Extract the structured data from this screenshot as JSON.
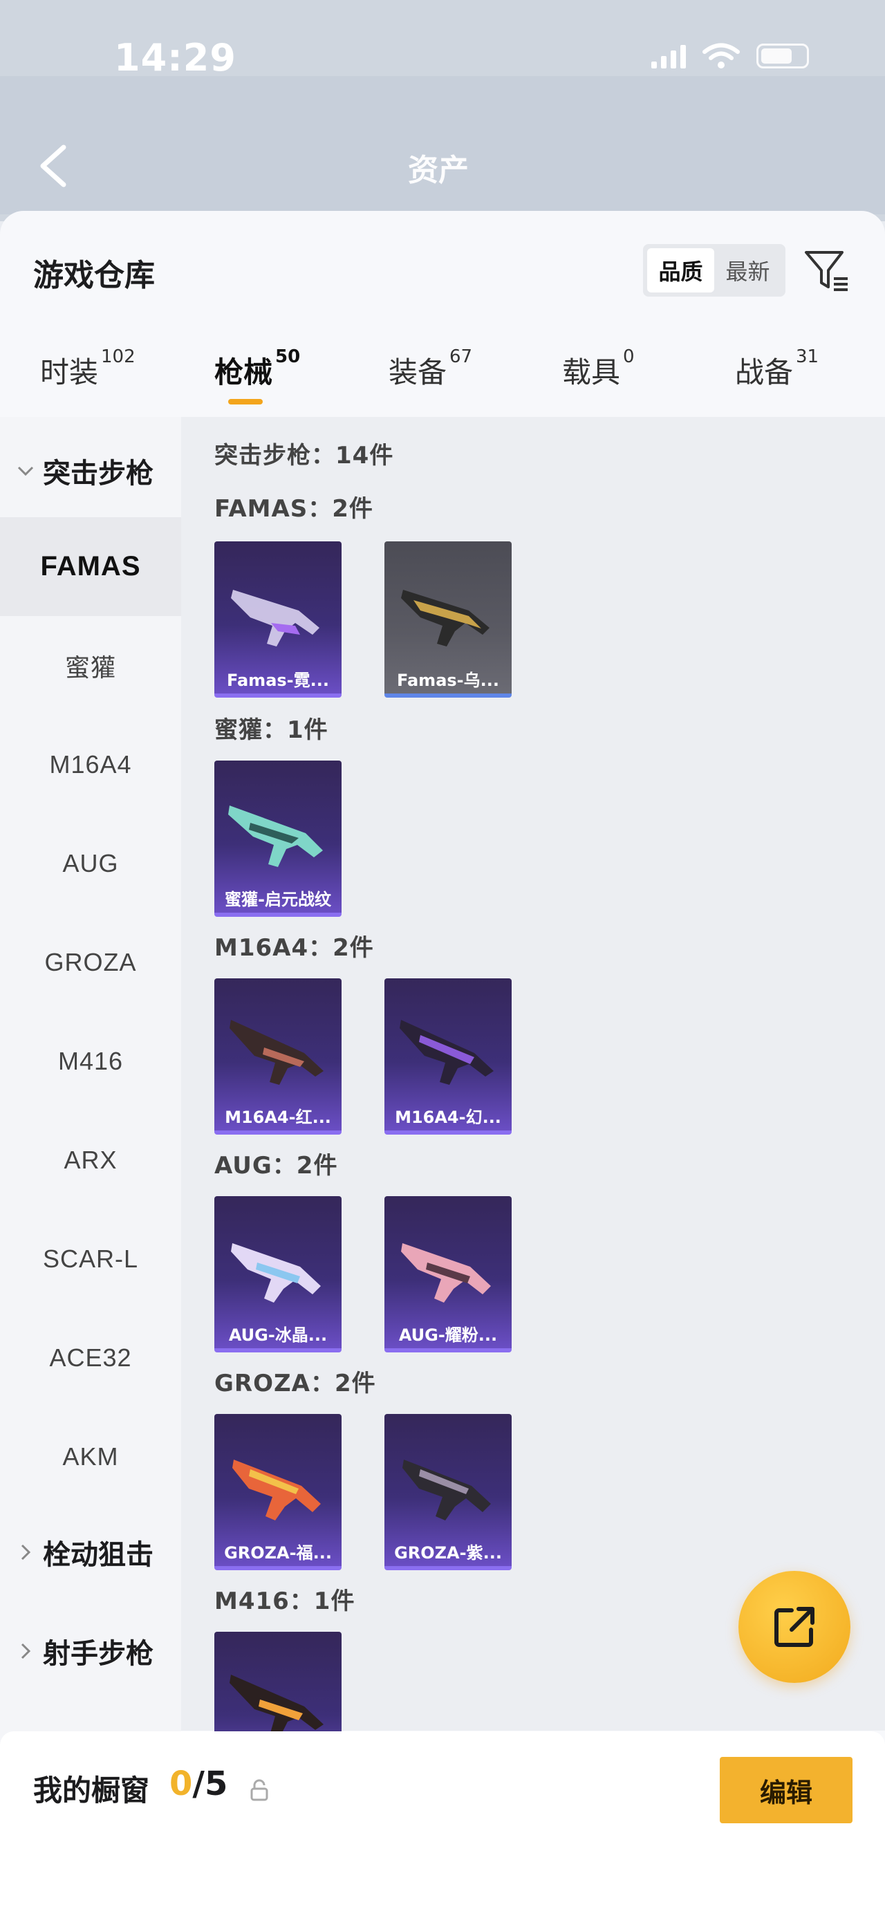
{
  "status_bar": {
    "time": "14:29"
  },
  "page": {
    "title": "资产"
  },
  "sheet": {
    "title": "游戏仓库",
    "sort": {
      "quality": "品质",
      "newest": "最新"
    }
  },
  "tabs": [
    {
      "label": "时装",
      "count": "102"
    },
    {
      "label": "枪械",
      "count": "50"
    },
    {
      "label": "装备",
      "count": "67"
    },
    {
      "label": "载具",
      "count": "0"
    },
    {
      "label": "战备",
      "count": "31"
    }
  ],
  "sidebar": {
    "groups": [
      "突击步枪",
      "栓动狙击",
      "射手步枪"
    ],
    "items": [
      "FAMAS",
      "蜜獾",
      "M16A4",
      "AUG",
      "GROZA",
      "M416",
      "ARX",
      "SCAR-L",
      "ACE32",
      "AKM"
    ]
  },
  "content": {
    "total": "突击步枪：14件",
    "sections": [
      {
        "heading": "FAMAS：2件",
        "items": [
          "Famas-霓...",
          "Famas-乌..."
        ]
      },
      {
        "heading": "蜜獾：1件",
        "items": [
          "蜜獾-启元战纹"
        ]
      },
      {
        "heading": "M16A4：2件",
        "items": [
          "M16A4-红...",
          "M16A4-幻..."
        ]
      },
      {
        "heading": "AUG：2件",
        "items": [
          "AUG-冰晶...",
          "AUG-耀粉..."
        ]
      },
      {
        "heading": "GROZA：2件",
        "items": [
          "GROZA-福...",
          "GROZA-紫..."
        ]
      },
      {
        "heading": "M416：1件",
        "items": [
          ""
        ]
      }
    ]
  },
  "showcase": {
    "title": "我的橱窗",
    "current": "0",
    "max": "/5",
    "edit_label": "编辑"
  },
  "colors": {
    "accent": "#f3b22e",
    "purple_card": "#3d2f78",
    "gray_card": "#5a5a63"
  },
  "icons": [
    "back-arrow-icon",
    "filter-icon",
    "chevron-down-icon",
    "chevron-right-icon",
    "share-icon",
    "lock-icon"
  ]
}
